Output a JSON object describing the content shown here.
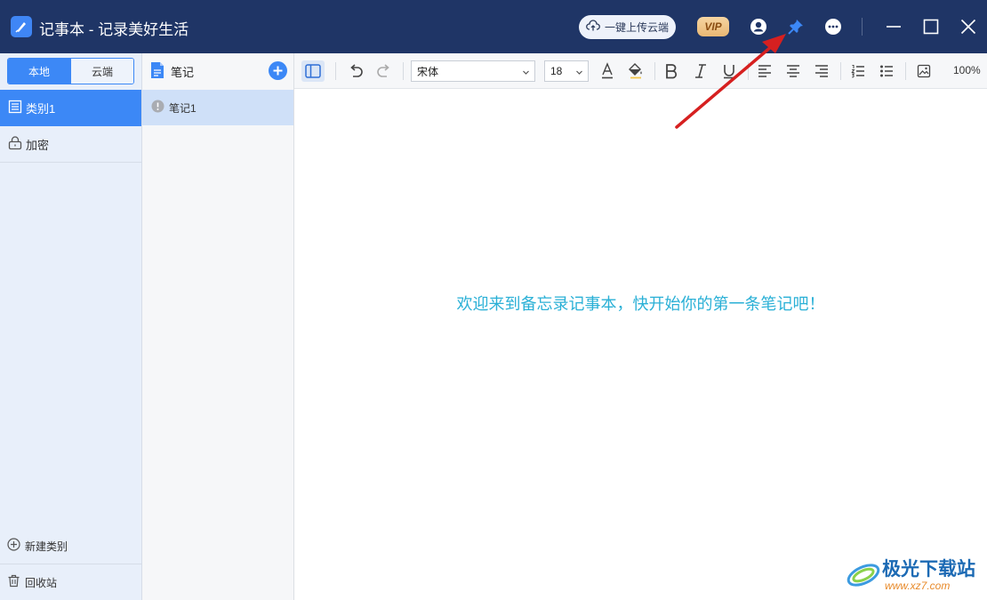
{
  "app": {
    "title": "记事本 - 记录美好生活",
    "upload_label": "一键上传云端",
    "vip_label": "VIP"
  },
  "sidebar": {
    "tabs": [
      {
        "label": "本地",
        "active": true
      },
      {
        "label": "云端",
        "active": false
      }
    ],
    "categories": [
      {
        "label": "类别1",
        "selected": true,
        "icon": "list-icon"
      },
      {
        "label": "加密",
        "selected": false,
        "icon": "lock-icon"
      }
    ],
    "new_category_label": "新建类别",
    "recycle_label": "回收站"
  },
  "notelist": {
    "header": "笔记",
    "notes": [
      {
        "label": "笔记1",
        "icon": "info-icon"
      }
    ]
  },
  "toolbar": {
    "font_family": "宋体",
    "font_size": "18",
    "zoom": "100%"
  },
  "editor": {
    "welcome": "欢迎来到备忘录记事本，快开始你的第一条笔记吧！"
  },
  "watermark": {
    "name": "极光下载站",
    "url": "www.xz7.com"
  },
  "colors": {
    "titlebar": "#1f3566",
    "accent": "#3c88f6",
    "welcome_text": "#2ab0d6",
    "annotation_arrow": "#d62020"
  }
}
